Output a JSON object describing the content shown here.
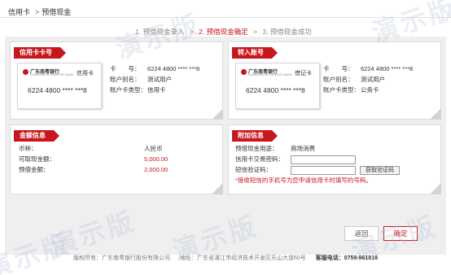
{
  "breadcrumb": {
    "root": "信用卡",
    "sep": ">",
    "current": "预借现金"
  },
  "steps": [
    {
      "label": "1. 预借现金录入",
      "active": false
    },
    {
      "label": "2. 预借现金确定",
      "active": true
    },
    {
      "label": "3. 预借现金成功",
      "active": false
    }
  ],
  "step_arrow": ">",
  "credit_panel": {
    "title": "信用卡卡号",
    "card": {
      "bank_name": "广东南粤银行",
      "bank_en": "GUANGDONG NANYUE BANK",
      "type": "信用卡",
      "number": "6224 4800 **** ***8"
    },
    "fields": [
      {
        "label": "卡　　号：",
        "value": "6224 4800 **** ***8"
      },
      {
        "label": "账户别名：",
        "value": "测试用户"
      },
      {
        "label": "账户卡类型：",
        "value": "信用卡"
      }
    ]
  },
  "debit_panel": {
    "title": "转入账号",
    "card": {
      "bank_name": "广东南粤银行",
      "bank_en": "GUANGDONG NANYUE BANK",
      "type": "借记卡",
      "number": "6224 4800 **** ***8"
    },
    "fields": [
      {
        "label": "卡　　号：",
        "value": "6224 4800 **** ***8"
      },
      {
        "label": "账户别名：",
        "value": "测试用户"
      },
      {
        "label": "账户卡类型：",
        "value": "公务卡"
      }
    ]
  },
  "amount_panel": {
    "title": "金额信息",
    "fields": [
      {
        "label": "币种：",
        "value": "人民币"
      },
      {
        "label": "可取现金额：",
        "value": "5,000.00"
      },
      {
        "label": "预借金额：",
        "value": "2,000.00"
      }
    ]
  },
  "extra_panel": {
    "title": "附加信息",
    "purpose_label": "预借现金用途：",
    "purpose_value": "商场消费",
    "password_label": "信用卡交易密码：",
    "password_value": "",
    "sms_label": "短信验证码：",
    "sms_value": "",
    "get_code_label": "获取验证码",
    "notice": "*接收短信的手机号为您申请信用卡时填写的号码。"
  },
  "actions": {
    "back_label": "返回",
    "confirm_label": "确定"
  },
  "watermark_text": "演示版",
  "footer": {
    "copyright": "版权所有：广东南粤银行股份有限公司",
    "address": "地址：广东省湛江市经济技术开发区乐山大道60号",
    "hotline": "客服电话：0759-961818"
  },
  "colors": {
    "accent": "#c8161e",
    "stage_bg": "#efefef"
  }
}
